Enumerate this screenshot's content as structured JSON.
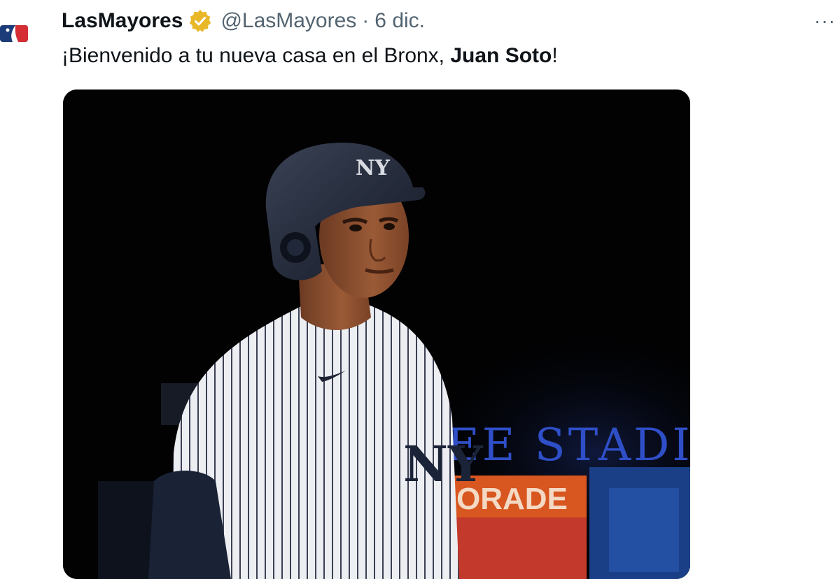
{
  "author": {
    "display_name": "LasMayores",
    "handle": "@LasMayores",
    "separator": "·",
    "date": "6 dic.",
    "verified_icon": "gold-verified-badge-icon",
    "avatar_icon": "mlb-logo-icon",
    "more_icon": "more-options-icon"
  },
  "tweet": {
    "text_prefix": "¡Bienvenido a tu nueva casa en el Bronx, ",
    "text_bold": "Juan Soto",
    "text_suffix": "!"
  },
  "media": {
    "background_signs": {
      "stadium": "EE STADI",
      "gatorade": "ORADE"
    }
  },
  "colors": {
    "verified": "#E8B829",
    "stadium_lettering": "#2f4fc8",
    "sign_background": "#d8561f"
  }
}
